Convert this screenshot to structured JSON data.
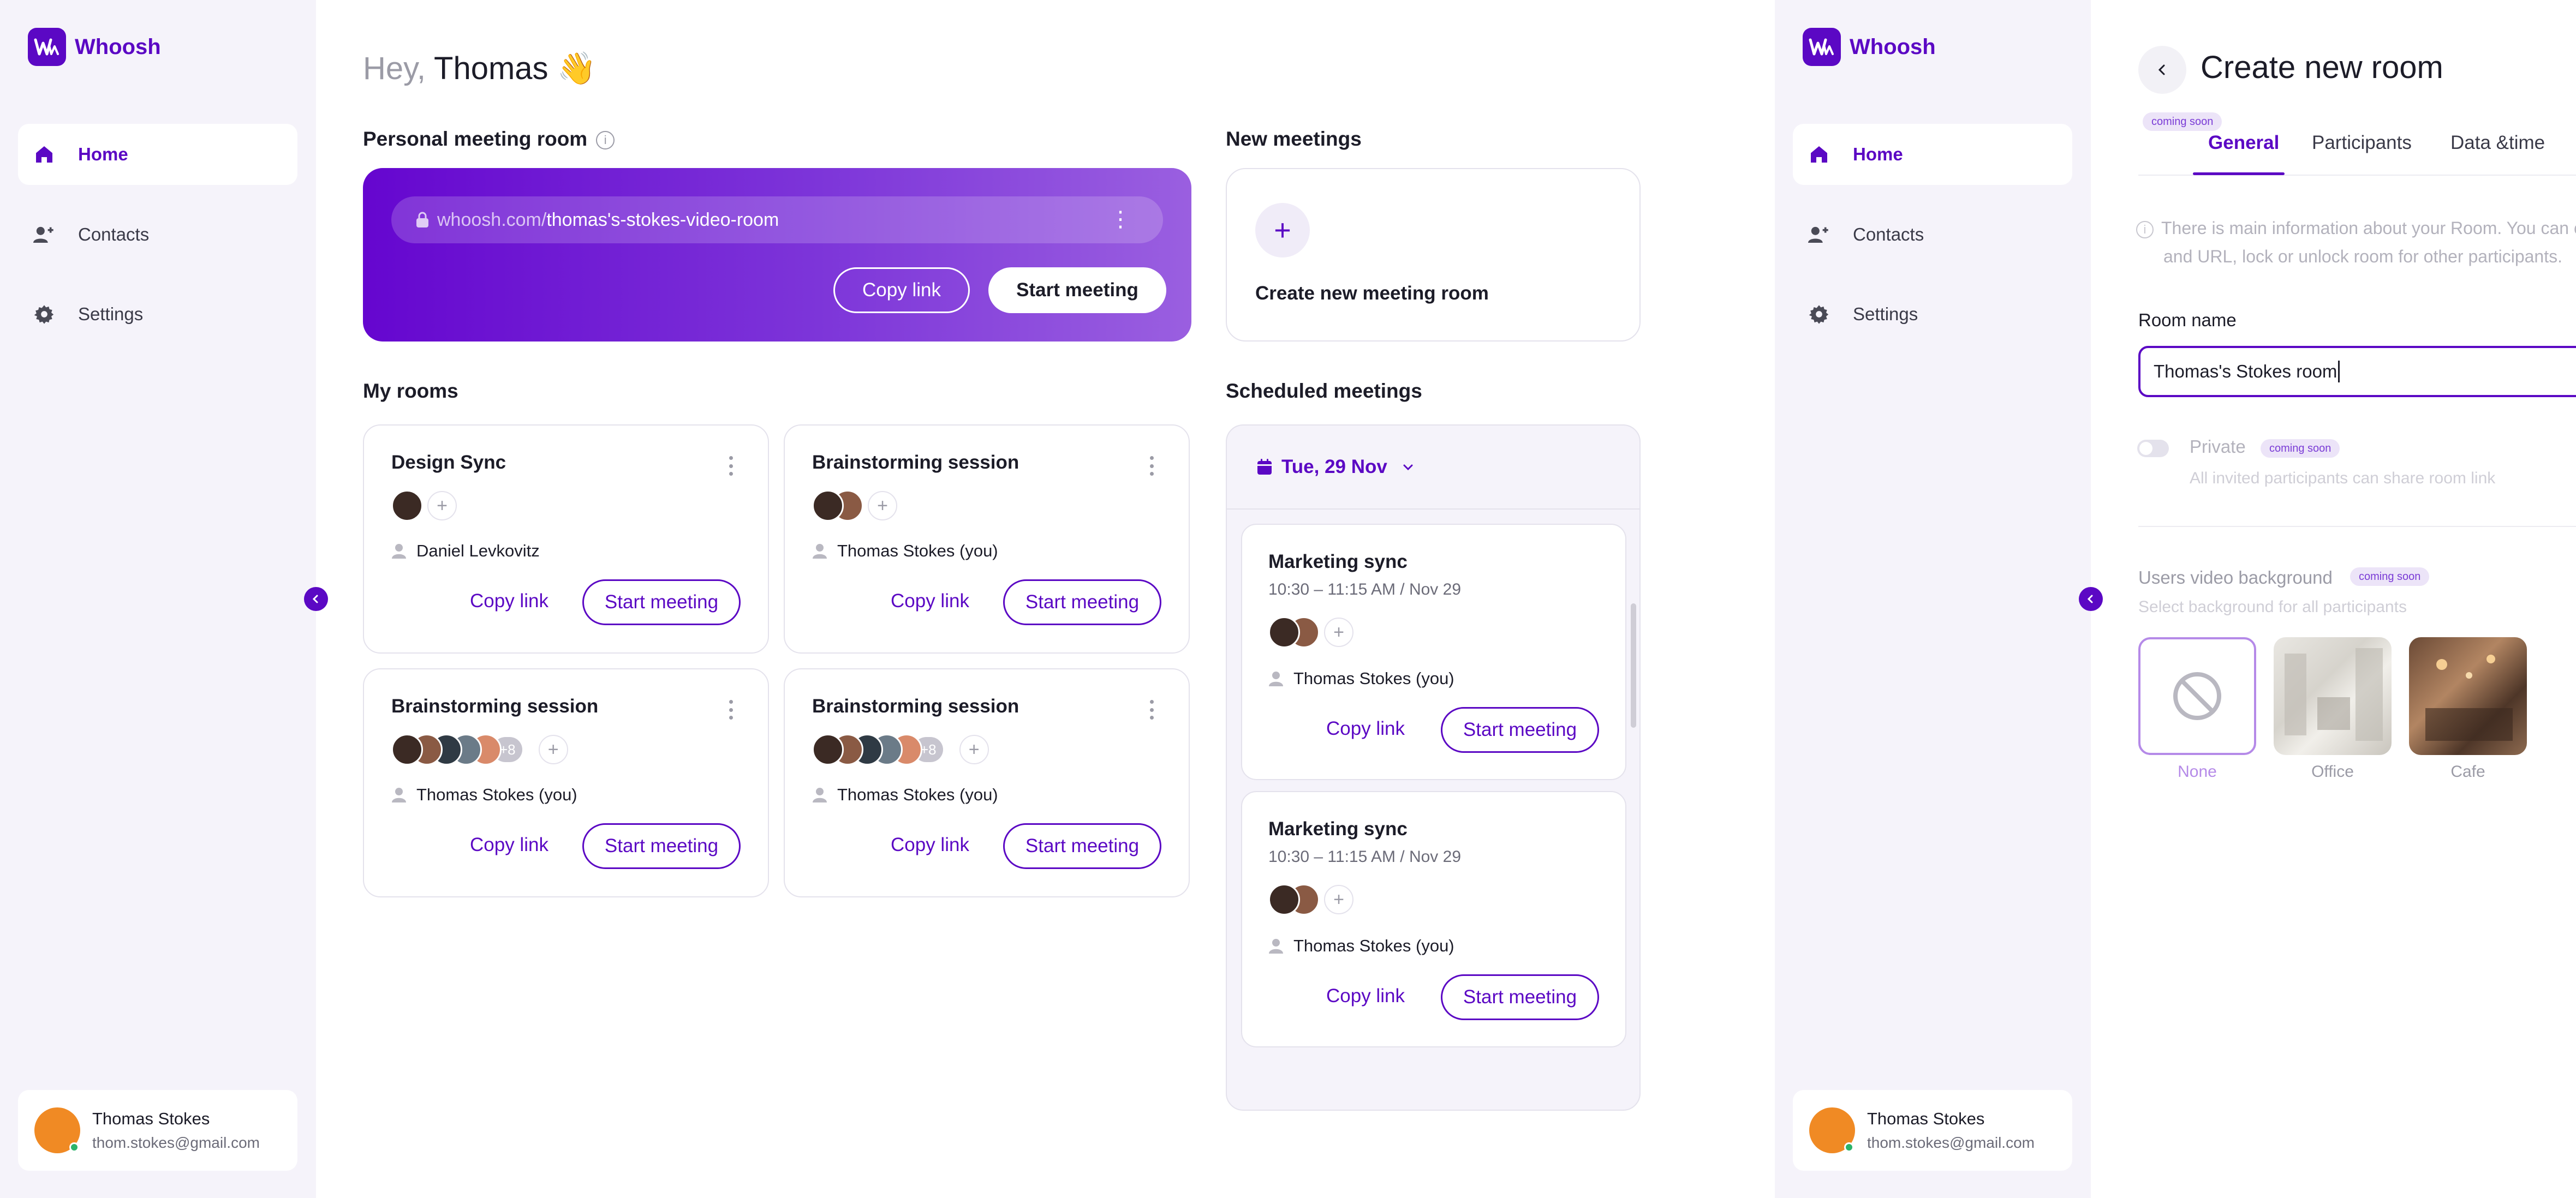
{
  "app": {
    "name": "Whoosh"
  },
  "colors": {
    "accent": "#5b08c4",
    "sidebar_bg": "#f5f3fa",
    "online": "#2bb36a"
  },
  "sidebar": {
    "items": [
      {
        "label": "Home",
        "icon": "home-icon",
        "active": true
      },
      {
        "label": "Contacts",
        "icon": "contacts-icon",
        "active": false
      },
      {
        "label": "Settings",
        "icon": "gear-icon",
        "active": false
      }
    ],
    "user": {
      "name": "Thomas Stokes",
      "email": "thom.stokes@gmail.com"
    }
  },
  "home": {
    "greeting_prefix": "Hey,",
    "greeting_name": "Thomas",
    "greeting_emoji": "👋",
    "personal_room": {
      "title": "Personal meeting room",
      "url_base": "whoosh.com/",
      "url_path": "thomas's-stokes-video-room",
      "copy_label": "Copy link",
      "start_label": "Start meeting"
    },
    "new_meetings": {
      "title": "New meetings",
      "create_label": "Create new meeting room"
    },
    "my_rooms": {
      "title": "My rooms",
      "rooms": [
        {
          "title": "Design Sync",
          "owner": "Daniel Levkovitz",
          "you": "",
          "extra": "",
          "copy": "Copy link",
          "start": "Start meeting"
        },
        {
          "title": "Brainstorming session",
          "owner": "Thomas Stokes",
          "you": "(you)",
          "extra": "",
          "copy": "Copy link",
          "start": "Start meeting"
        },
        {
          "title": "Brainstorming session",
          "owner": "Thomas Stokes",
          "you": "(you)",
          "extra": "+8",
          "copy": "Copy link",
          "start": "Start meeting"
        },
        {
          "title": "Brainstorming session",
          "owner": "Thomas Stokes",
          "you": "(you)",
          "extra": "+8",
          "copy": "Copy link",
          "start": "Start meeting"
        }
      ]
    },
    "scheduled": {
      "title": "Scheduled meetings",
      "date": "Tue, 29 Nov",
      "meetings": [
        {
          "title": "Marketing sync",
          "time": "10:30 – 11:15 AM / Nov 29",
          "owner": "Thomas Stokes",
          "you": "(you)",
          "copy": "Copy link",
          "start": "Start meeting"
        },
        {
          "title": "Marketing sync",
          "time": "10:30 – 11:15 AM / Nov 29",
          "owner": "Thomas Stokes",
          "you": "(you)",
          "copy": "Copy link",
          "start": "Start meeting"
        }
      ]
    }
  },
  "create_room": {
    "title": "Create new room",
    "coming_soon": "coming soon",
    "tabs": [
      "General",
      "Participants",
      "Data &time"
    ],
    "help_text_1": "There is main information about your Room. You can c",
    "help_text_2": "and URL, lock or unlock room for other participants.",
    "room_name_label": "Room name",
    "room_name_value": "Thomas's Stokes room",
    "private_label": "Private",
    "private_help": "All invited participants can share room link",
    "bg_label": "Users video background",
    "bg_help": "Select background for all participants",
    "backgrounds": [
      "None",
      "Office",
      "Cafe"
    ]
  }
}
